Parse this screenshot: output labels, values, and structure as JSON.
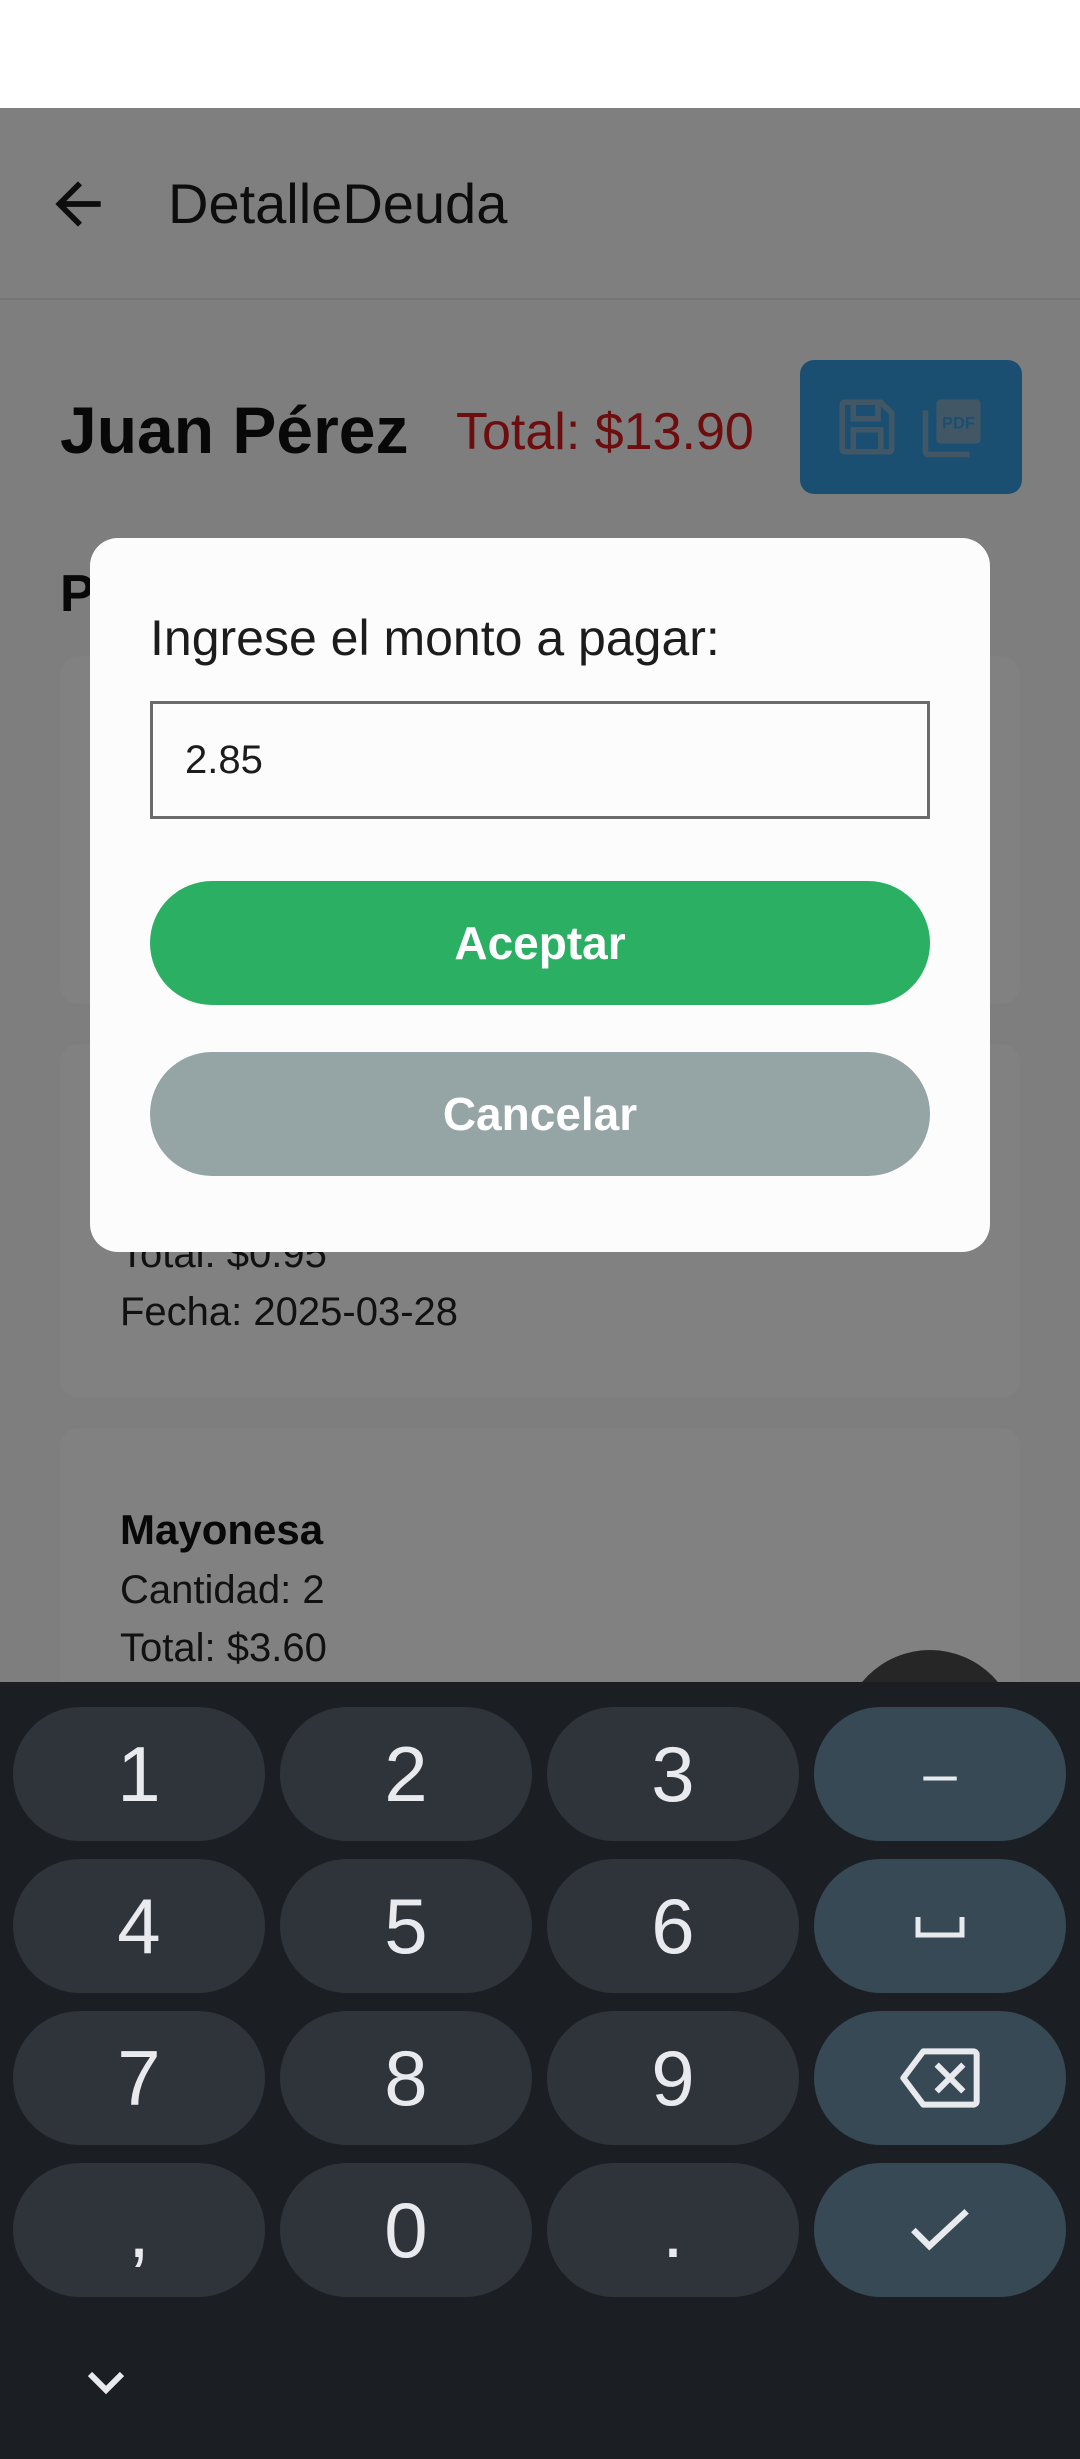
{
  "app_bar": {
    "title": "DetalleDeuda"
  },
  "customer": {
    "name": "Juan Pérez",
    "total": "Total: $13.90"
  },
  "section": {
    "heading_initial": "P"
  },
  "items": [
    {
      "visible_lines": []
    },
    {
      "total": "Total: $0.95",
      "date": "Fecha: 2025-03-28"
    },
    {
      "name": "Mayonesa",
      "quantity": "Cantidad: 2",
      "total": "Total: $3.60"
    }
  ],
  "dialog": {
    "prompt": "Ingrese el monto a pagar:",
    "amount_value": "2.85",
    "accept_label": "Aceptar",
    "cancel_label": "Cancelar"
  },
  "keyboard": {
    "row1": [
      "1",
      "2",
      "3",
      "–"
    ],
    "row2": [
      "4",
      "5",
      "6",
      "␣"
    ],
    "row3": [
      "7",
      "8",
      "9",
      "backspace"
    ],
    "row4": [
      ",",
      "0",
      ".",
      "done"
    ]
  },
  "colors": {
    "total_red": "#d11a1a",
    "action_blue": "#3498db",
    "accept_green": "#2bb063",
    "cancel_gray": "#95a5a6",
    "keyboard_bg": "#1b1f24"
  }
}
